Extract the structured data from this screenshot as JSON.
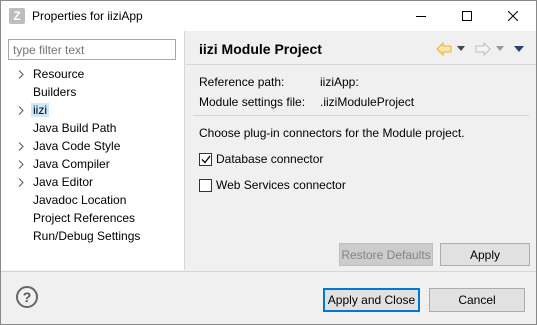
{
  "window": {
    "title": "Properties for iiziApp",
    "app_icon_letter": "Z"
  },
  "filter": {
    "placeholder": "type filter text"
  },
  "tree": {
    "items": [
      {
        "label": "Resource",
        "expandable": true,
        "selected": false
      },
      {
        "label": "Builders",
        "expandable": false,
        "selected": false
      },
      {
        "label": "iizi",
        "expandable": true,
        "selected": true
      },
      {
        "label": "Java Build Path",
        "expandable": false,
        "selected": false
      },
      {
        "label": "Java Code Style",
        "expandable": true,
        "selected": false
      },
      {
        "label": "Java Compiler",
        "expandable": true,
        "selected": false
      },
      {
        "label": "Java Editor",
        "expandable": true,
        "selected": false
      },
      {
        "label": "Javadoc Location",
        "expandable": false,
        "selected": false
      },
      {
        "label": "Project References",
        "expandable": false,
        "selected": false
      },
      {
        "label": "Run/Debug Settings",
        "expandable": false,
        "selected": false
      }
    ]
  },
  "page": {
    "title": "iizi Module Project",
    "reference_path_label": "Reference path:",
    "reference_path_value": "iiziApp:",
    "module_settings_label": "Module settings file:",
    "module_settings_value": ".iiziModuleProject",
    "description": "Choose plug-in connectors for the Module project.",
    "connectors": [
      {
        "label": "Database connector",
        "checked": true
      },
      {
        "label": "Web Services connector",
        "checked": false
      }
    ],
    "restore_defaults_label": "Restore Defaults",
    "apply_label": "Apply"
  },
  "footer": {
    "apply_and_close_label": "Apply and Close",
    "cancel_label": "Cancel"
  },
  "colors": {
    "selection": "#cce8ff",
    "accent": "#0078d7",
    "back_arrow": "#e6b33a"
  }
}
